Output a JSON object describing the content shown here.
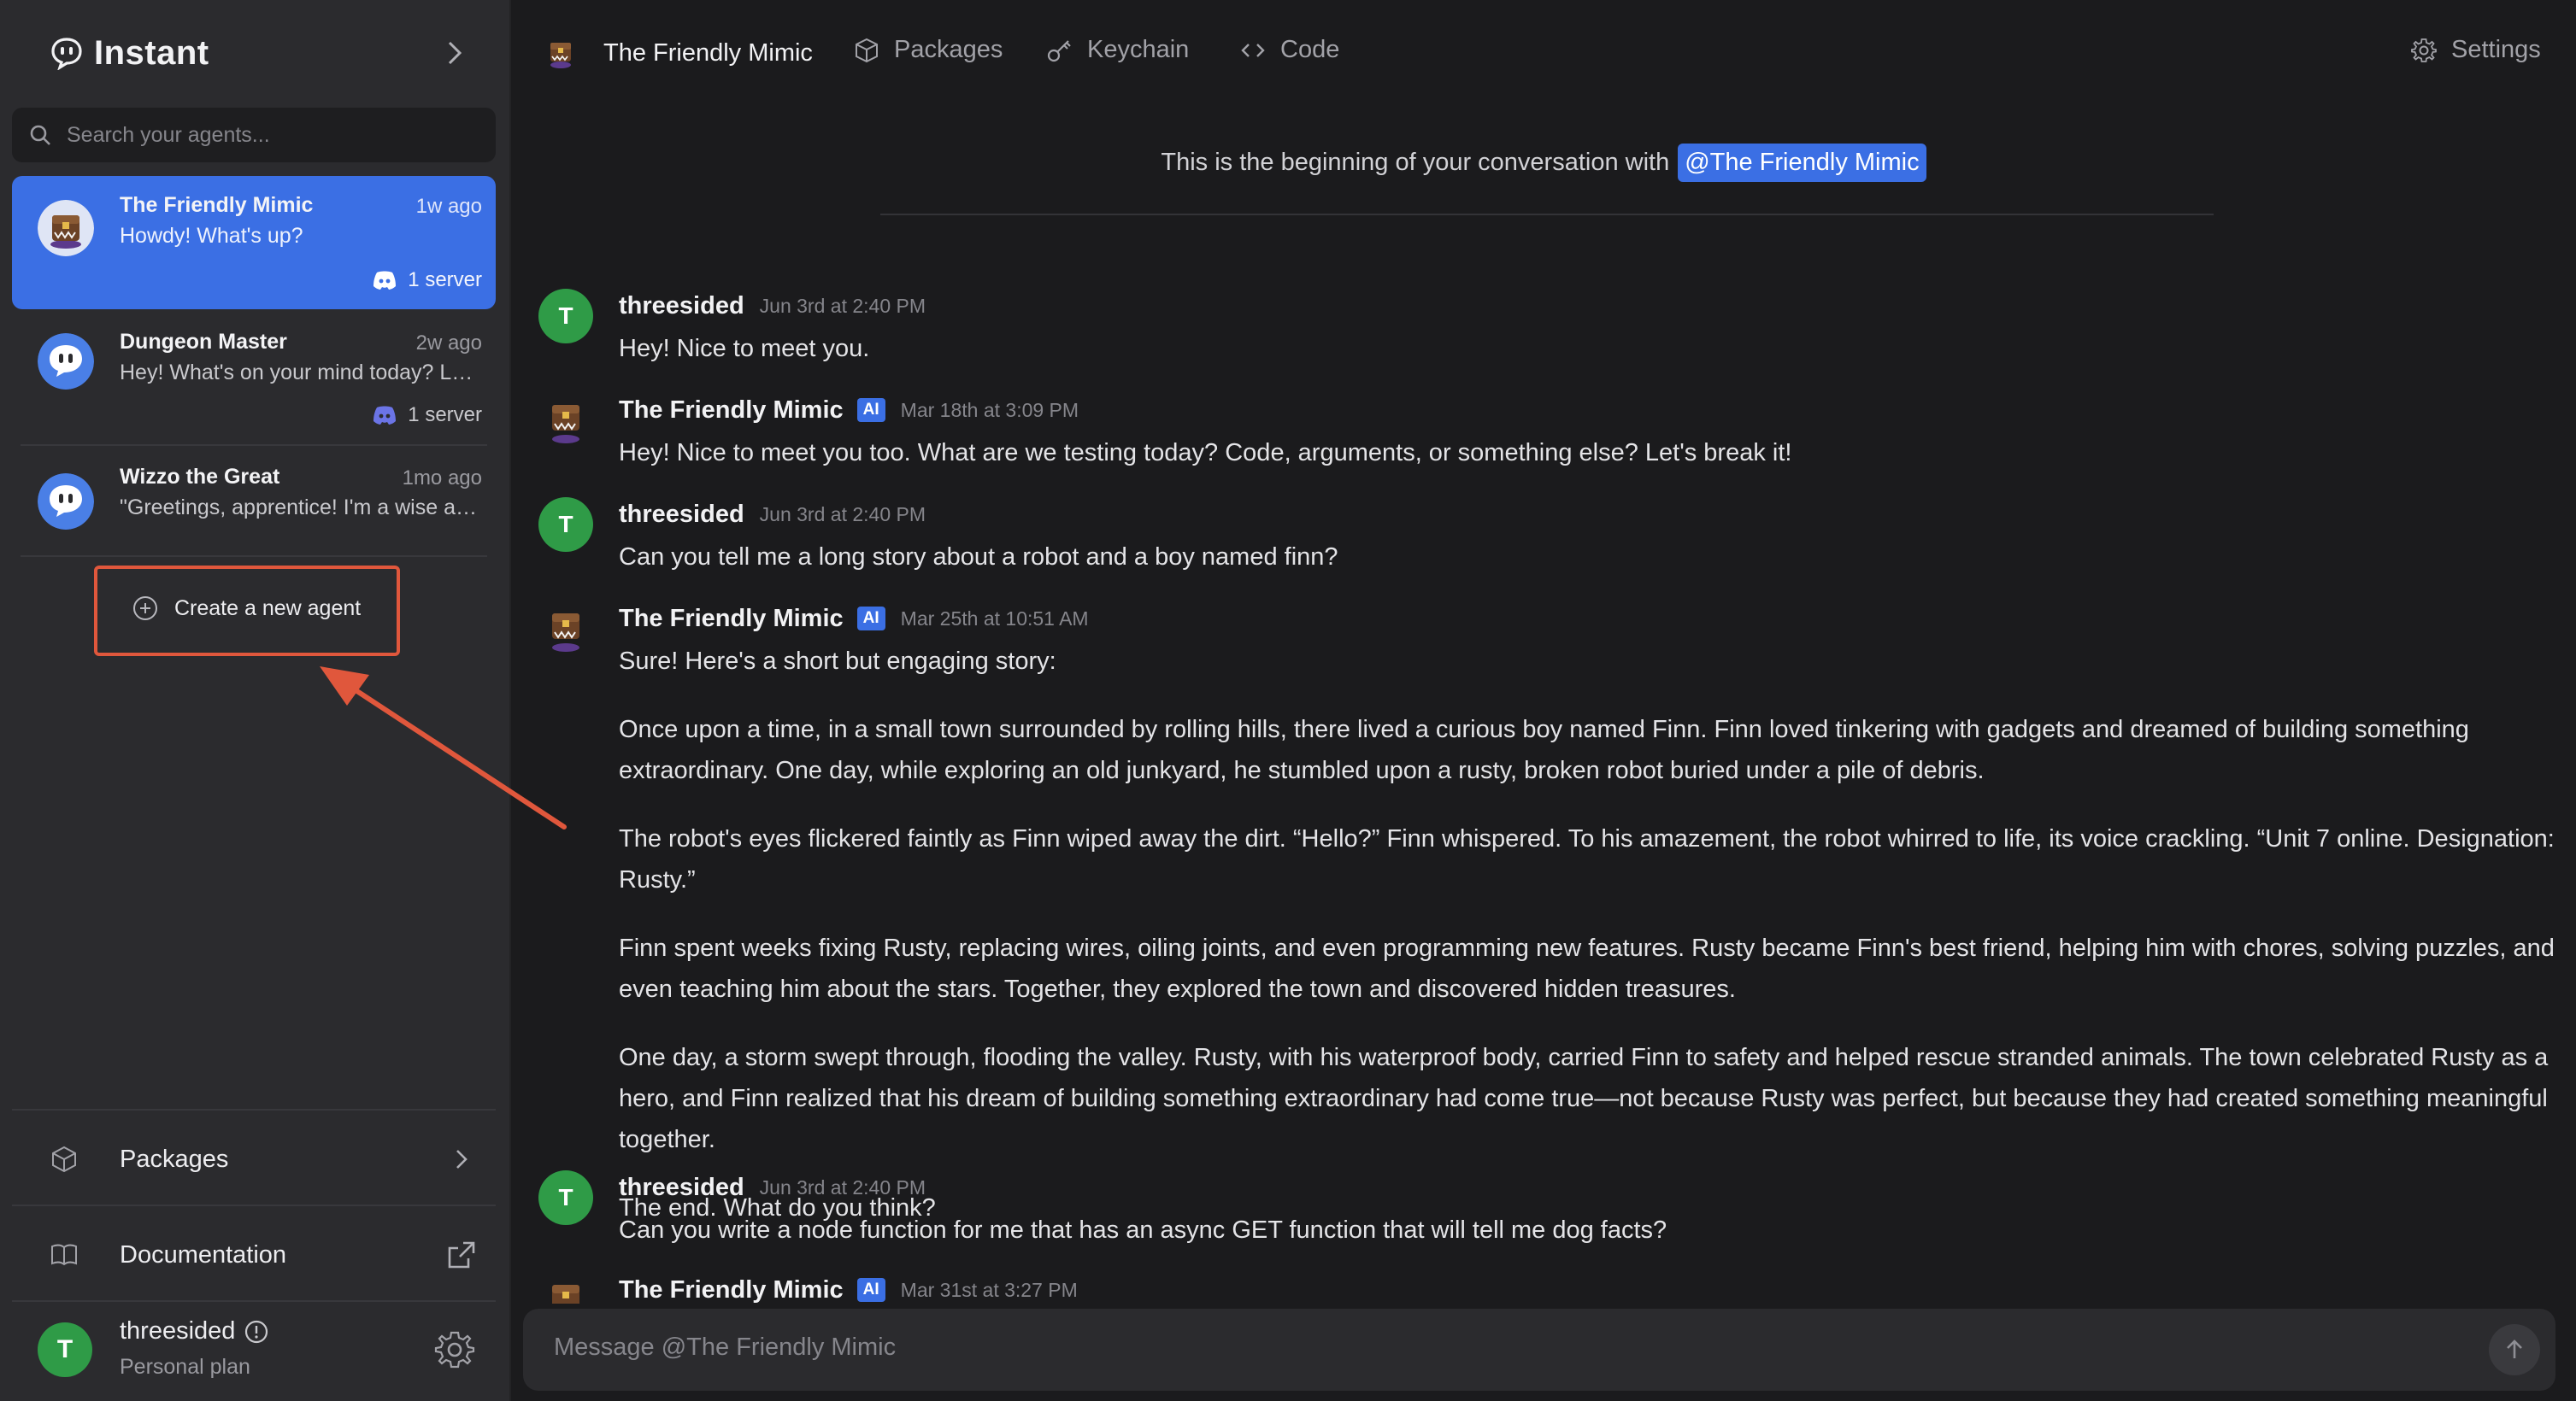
{
  "app": {
    "name": "Instant"
  },
  "sidebar": {
    "search_placeholder": "Search your agents...",
    "agents": [
      {
        "name": "The Friendly Mimic",
        "time": "1w ago",
        "preview": "Howdy! What's up?",
        "servers": "1 server",
        "active": true
      },
      {
        "name": "Dungeon Master",
        "time": "2w ago",
        "preview": "Hey! What's on your mind today? Looking for...",
        "servers": "1 server",
        "active": false
      },
      {
        "name": "Wizzo the Great",
        "time": "1mo ago",
        "preview": "\"Greetings, apprentice! I'm a wise and...",
        "active": false
      }
    ],
    "create_label": "Create a new agent",
    "links": {
      "packages": "Packages",
      "documentation": "Documentation"
    },
    "user": {
      "initial": "T",
      "name": "threesided",
      "plan": "Personal plan"
    }
  },
  "topnav": {
    "agent": "The Friendly Mimic",
    "packages": "Packages",
    "keychain": "Keychain",
    "code": "Code",
    "settings": "Settings"
  },
  "conversation": {
    "beginning_text": "This is the beginning of your conversation with",
    "mention": "@The Friendly Mimic",
    "messages": [
      {
        "author": "threesided",
        "initial": "T",
        "is_ai": false,
        "timestamp": "Jun 3rd at 2:40 PM",
        "paragraphs": [
          "Hey! Nice to meet you."
        ]
      },
      {
        "author": "The Friendly Mimic",
        "is_ai": true,
        "ai_badge": "AI",
        "timestamp": "Mar 18th at 3:09 PM",
        "paragraphs": [
          "Hey! Nice to meet you too. What are we testing today? Code, arguments, or something else? Let's break it!"
        ]
      },
      {
        "author": "threesided",
        "initial": "T",
        "is_ai": false,
        "timestamp": "Jun 3rd at 2:40 PM",
        "paragraphs": [
          "Can you tell me a long story about a robot and a boy named finn?"
        ]
      },
      {
        "author": "The Friendly Mimic",
        "is_ai": true,
        "ai_badge": "AI",
        "timestamp": "Mar 25th at 10:51 AM",
        "paragraphs": [
          "Sure! Here's a short but engaging story:",
          "Once upon a time, in a small town surrounded by rolling hills, there lived a curious boy named Finn. Finn loved tinkering with gadgets and dreamed of building something extraordinary. One day, while exploring an old junkyard, he stumbled upon a rusty, broken robot buried under a pile of debris.",
          "The robot's eyes flickered faintly as Finn wiped away the dirt. “Hello?” Finn whispered. To his amazement, the robot whirred to life, its voice crackling. “Unit 7 online. Designation: Rusty.”",
          "Finn spent weeks fixing Rusty, replacing wires, oiling joints, and even programming new features. Rusty became Finn's best friend, helping him with chores, solving puzzles, and even teaching him about the stars. Together, they explored the town and discovered hidden treasures.",
          "One day, a storm swept through, flooding the valley. Rusty, with his waterproof body, carried Finn to safety and helped rescue stranded animals. The town celebrated Rusty as a hero, and Finn realized that his dream of building something extraordinary had come true—not because Rusty was perfect, but because they had created something meaningful together.",
          "The end. What do you think?"
        ]
      },
      {
        "author": "threesided",
        "initial": "T",
        "is_ai": false,
        "timestamp": "Jun 3rd at 2:40 PM",
        "paragraphs": [
          "Can you write a node function for me that has an async GET function that will tell me dog facts?"
        ]
      },
      {
        "author": "The Friendly Mimic",
        "is_ai": true,
        "ai_badge": "AI",
        "timestamp": "Mar 31st at 3:27 PM",
        "paragraphs": []
      }
    ]
  },
  "composer": {
    "placeholder": "Message @The Friendly Mimic"
  },
  "colors": {
    "accent": "#3b6fe4",
    "highlight_box": "#e0573c",
    "user_avatar": "#2f9b47"
  }
}
